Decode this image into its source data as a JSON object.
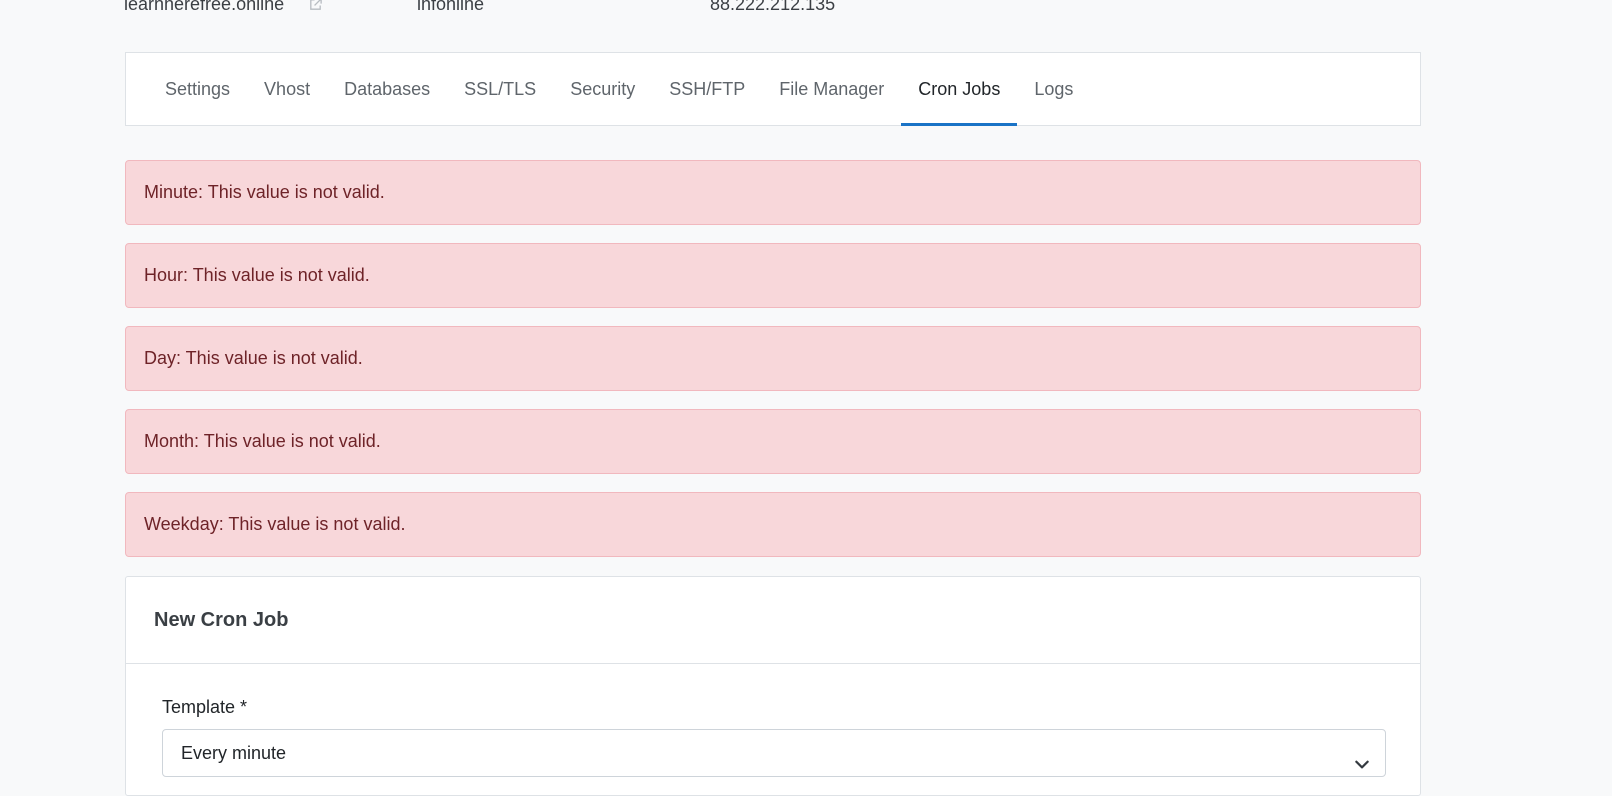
{
  "site": {
    "domain": "learnherefree.online",
    "user": "lhfonline",
    "ip": "88.222.212.135"
  },
  "tabs": [
    {
      "label": "Settings"
    },
    {
      "label": "Vhost"
    },
    {
      "label": "Databases"
    },
    {
      "label": "SSL/TLS"
    },
    {
      "label": "Security"
    },
    {
      "label": "SSH/FTP"
    },
    {
      "label": "File Manager"
    },
    {
      "label": "Cron Jobs",
      "active": true
    },
    {
      "label": "Logs"
    }
  ],
  "alerts": [
    "Minute: This value is not valid.",
    "Hour: This value is not valid.",
    "Day: This value is not valid.",
    "Month: This value is not valid.",
    "Weekday: This value is not valid."
  ],
  "form": {
    "title": "New Cron Job",
    "template_label": "Template *",
    "template_value": "Every minute"
  },
  "colors": {
    "accent": "#1a73c6",
    "alert_bg": "#f8d7da",
    "alert_text": "#6e2328"
  },
  "icons": {
    "external_link": "external-link-icon",
    "dropdown": "chevron-down-icon"
  }
}
